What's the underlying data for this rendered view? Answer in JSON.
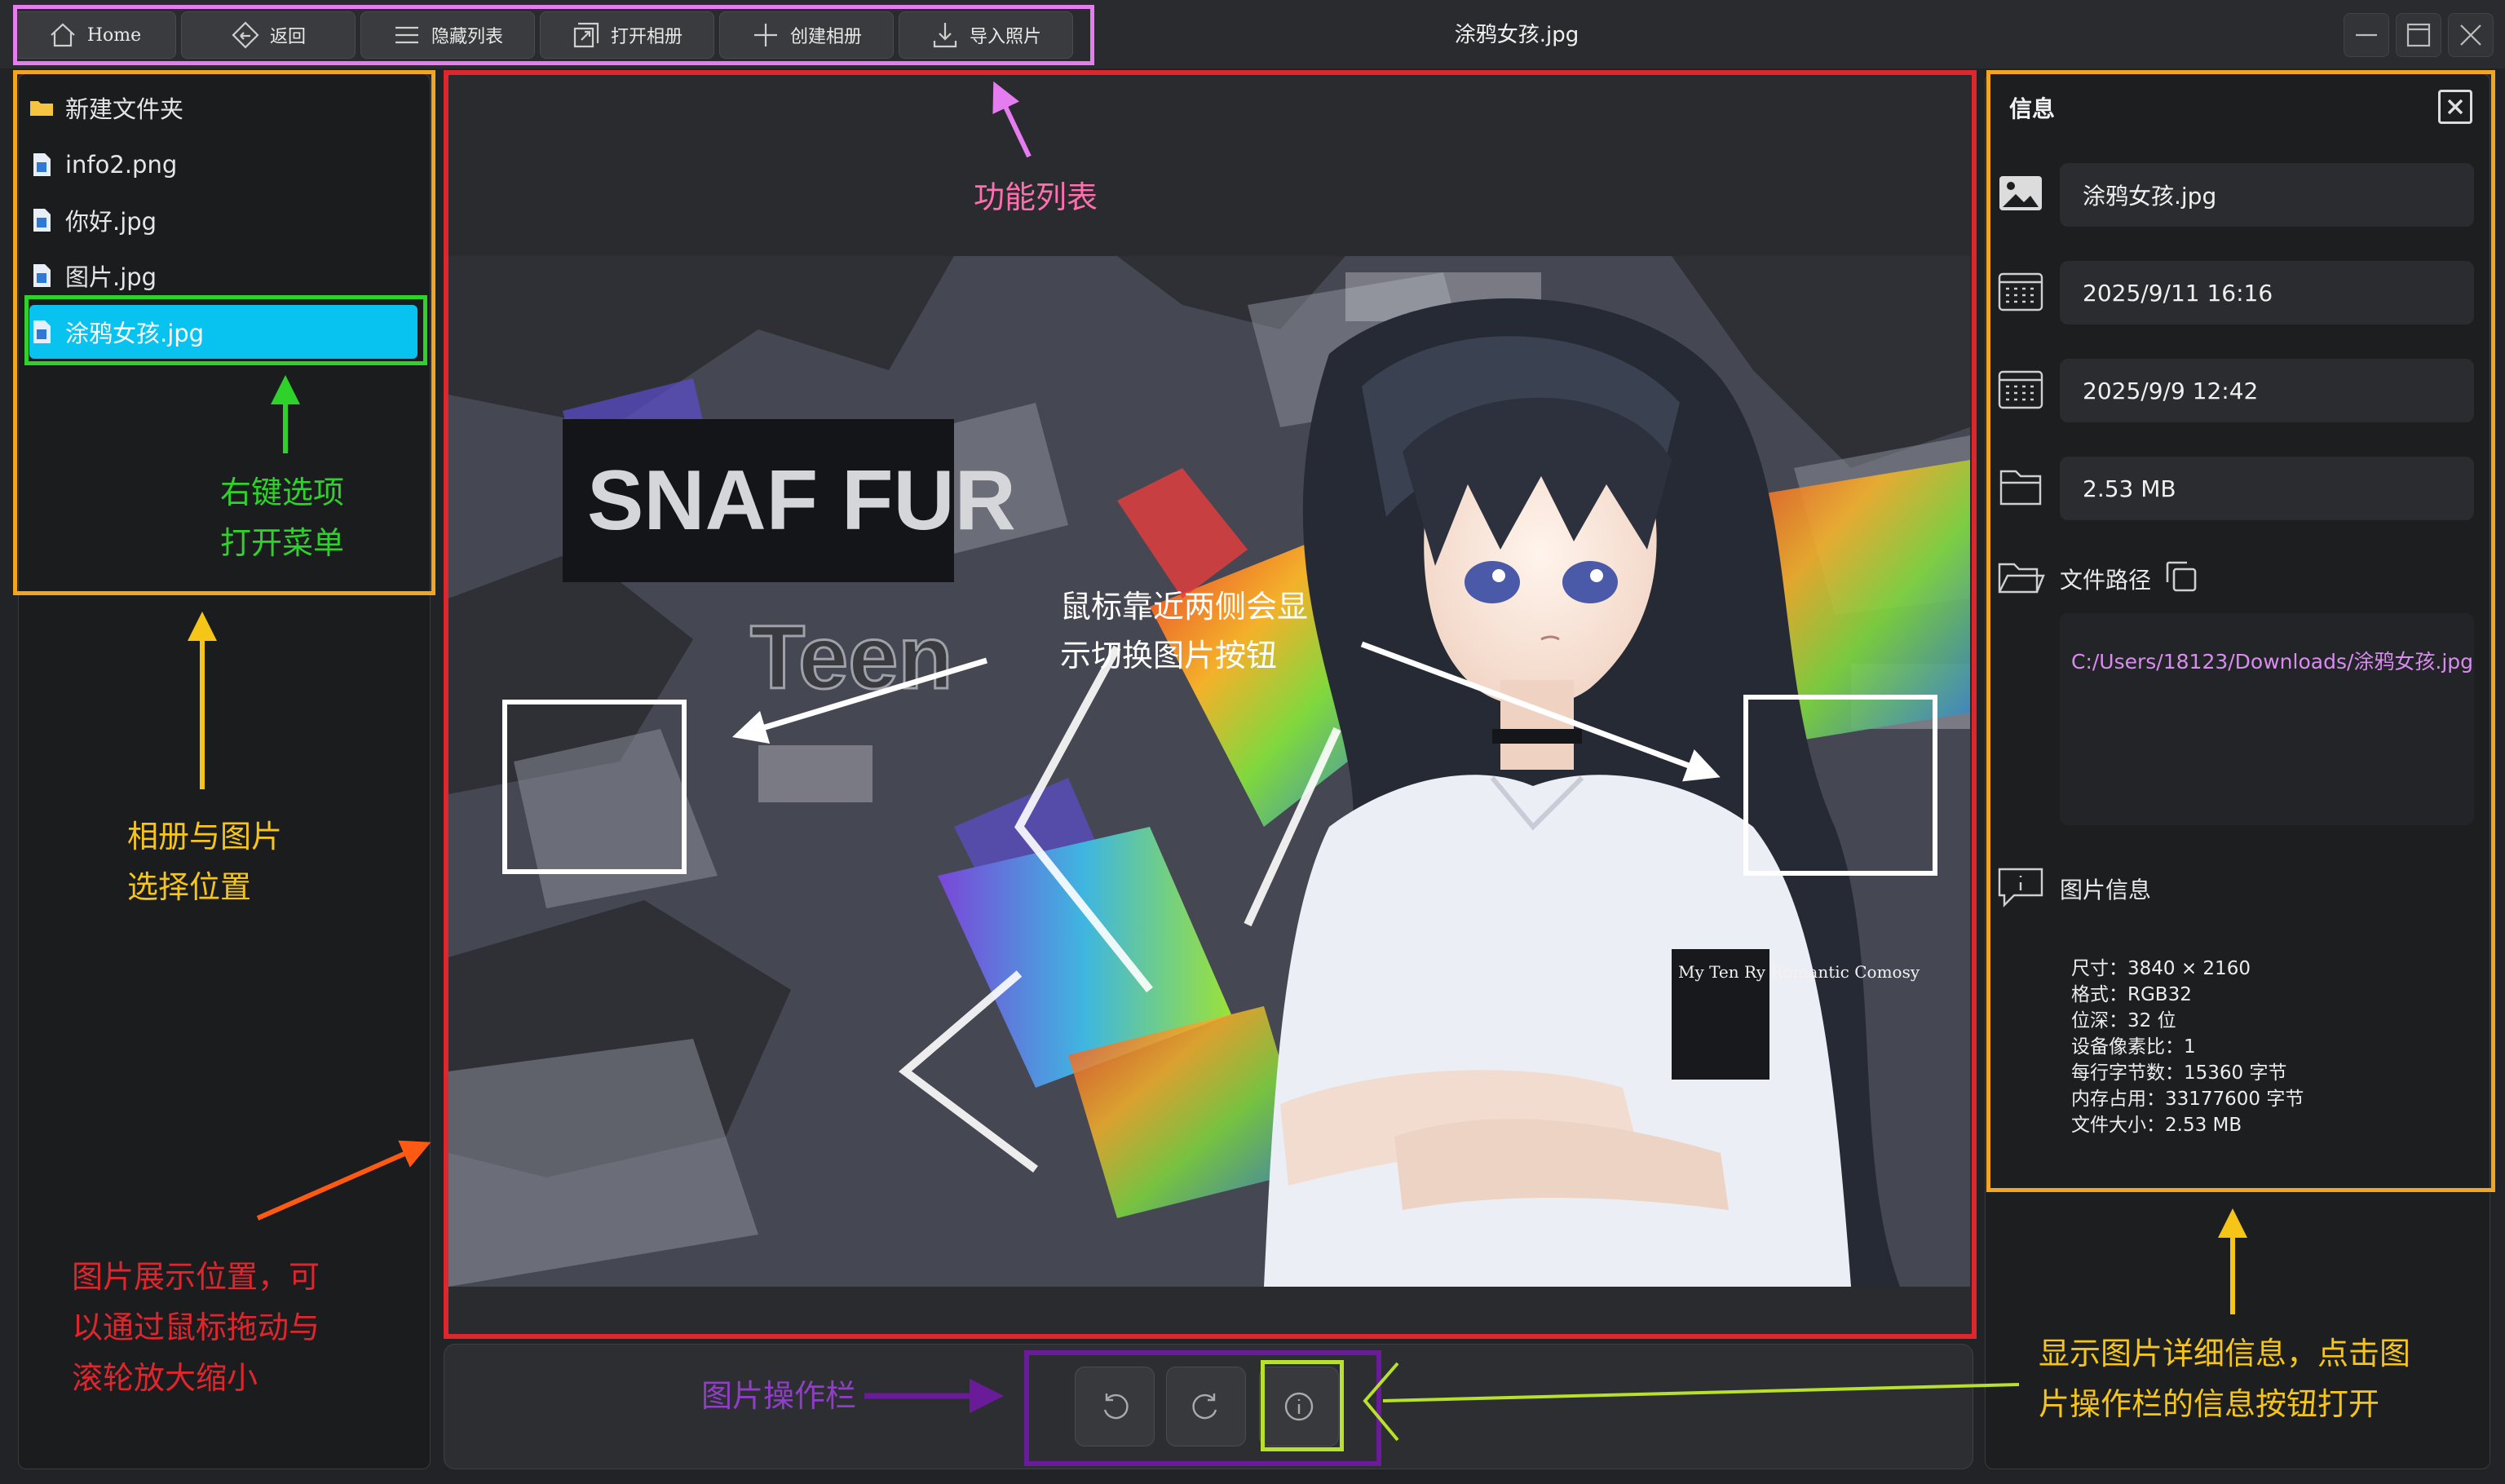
{
  "window": {
    "title": "涂鸦女孩.jpg"
  },
  "toolbar": {
    "buttons": [
      {
        "label": "Home",
        "icon": "home-icon"
      },
      {
        "label": "返回",
        "icon": "back-icon"
      },
      {
        "label": "隐藏列表",
        "icon": "list-icon"
      },
      {
        "label": "打开相册",
        "icon": "open-album-icon"
      },
      {
        "label": "创建相册",
        "icon": "plus-icon"
      },
      {
        "label": "导入照片",
        "icon": "import-icon"
      }
    ]
  },
  "window_controls": [
    "minimize-icon",
    "maximize-icon",
    "close-icon"
  ],
  "file_list": {
    "items": [
      {
        "label": "新建文件夹",
        "type": "folder"
      },
      {
        "label": "info2.png",
        "type": "image"
      },
      {
        "label": "你好.jpg",
        "type": "image"
      },
      {
        "label": "图片.jpg",
        "type": "image"
      },
      {
        "label": "涂鸦女孩.jpg",
        "type": "image",
        "selected": true
      }
    ]
  },
  "viewer": {
    "image_text": [
      "SNAF FUR",
      "Teen",
      "My Ten Ry Romantic Comosy"
    ]
  },
  "op_bar": {
    "buttons": [
      "rotate-left-icon",
      "rotate-right-icon",
      "info-icon"
    ]
  },
  "info_panel": {
    "title": "信息",
    "file_name": "涂鸦女孩.jpg",
    "date_1": "2025/9/11 16:16",
    "date_2": "2025/9/9 12:42",
    "size": "2.53 MB",
    "path_label": "文件路径",
    "path": "C:/Users/18123/Downloads/涂鸦女孩.jpg",
    "image_info_label": "图片信息",
    "details": [
      "尺寸：3840 × 2160",
      "格式：RGB32",
      "位深：32 位",
      "设备像素比：1",
      "每行字节数：15360 字节",
      "内存占用：33177600 字节",
      "文件大小：2.53 MB"
    ]
  },
  "annotations": {
    "function_list": "功能列表",
    "right_click_1": "右键选项",
    "right_click_2": "打开菜单",
    "album_1": "相册与图片",
    "album_2": "选择位置",
    "hover_1": "鼠标靠近两侧会显",
    "hover_2": "示切换图片按钮",
    "display_1": "图片展示位置，可",
    "display_2": "以通过鼠标拖动与",
    "display_3": "滚轮放大缩小",
    "op_bar": "图片操作栏",
    "detail_1": "显示图片详细信息，点击图",
    "detail_2": "片操作栏的信息按钮打开"
  },
  "colors": {
    "selection": "#08c3f0",
    "frame_toolbar": "#e57cf0",
    "frame_left": "#f2a51f",
    "frame_selected": "#2fd22a",
    "frame_viewer": "#e0262d",
    "frame_opbar": "#6a1b9a",
    "frame_info_button": "#b7e12a",
    "path_text": "#d98cf0"
  }
}
